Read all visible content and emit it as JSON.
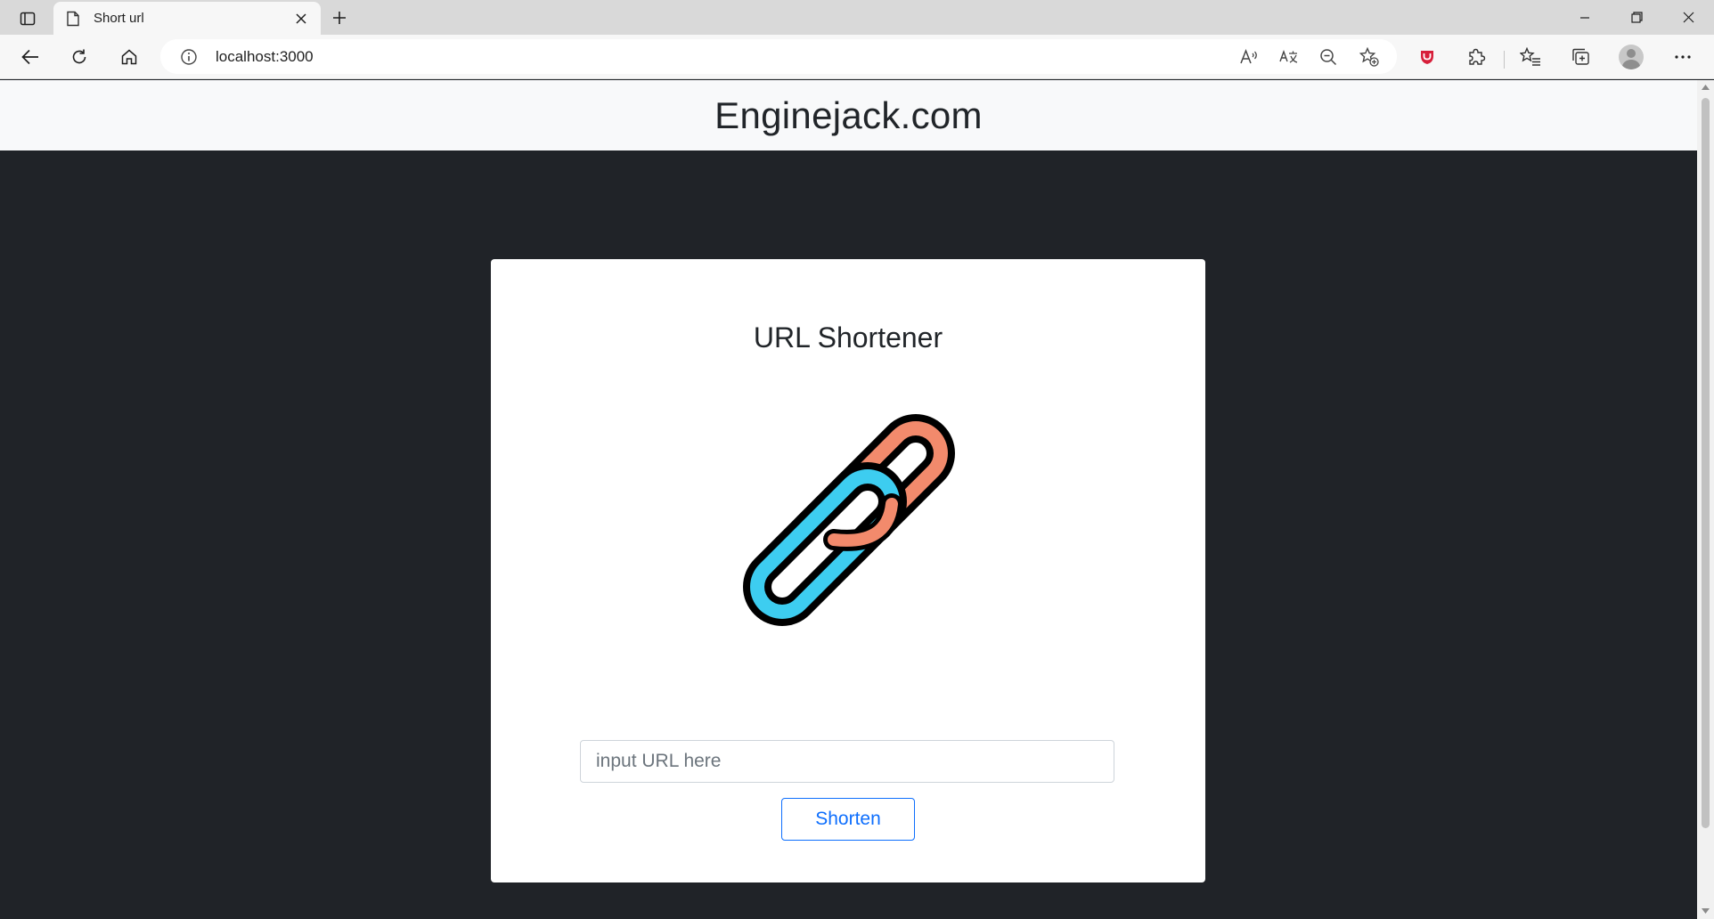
{
  "browser": {
    "tab": {
      "title": "Short url"
    },
    "address": {
      "url": "localhost:3000"
    }
  },
  "icons": [
    "tab-actions-icon",
    "page-icon",
    "close-icon",
    "plus-icon",
    "minimize-icon",
    "restore-icon",
    "window-close-icon",
    "back-icon",
    "refresh-icon",
    "home-icon",
    "info-icon",
    "read-aloud-icon",
    "translate-icon",
    "zoom-out-icon",
    "add-favorite-icon",
    "shield-extension-icon",
    "extensions-icon",
    "favorites-icon",
    "collections-icon",
    "profile-avatar-icon",
    "more-icon"
  ],
  "page": {
    "site_title": "Enginejack.com",
    "card": {
      "heading": "URL Shortener",
      "logo": "chain-link-icon",
      "input": {
        "placeholder": "input URL here",
        "value": ""
      },
      "button": "Shorten"
    }
  },
  "colors": {
    "page_background": "#202328",
    "header_background": "#f8f9fa",
    "card_background": "#ffffff",
    "button_accent": "#0d6efd",
    "link_orange": "#f28a6c",
    "link_blue": "#3dcdf0"
  }
}
